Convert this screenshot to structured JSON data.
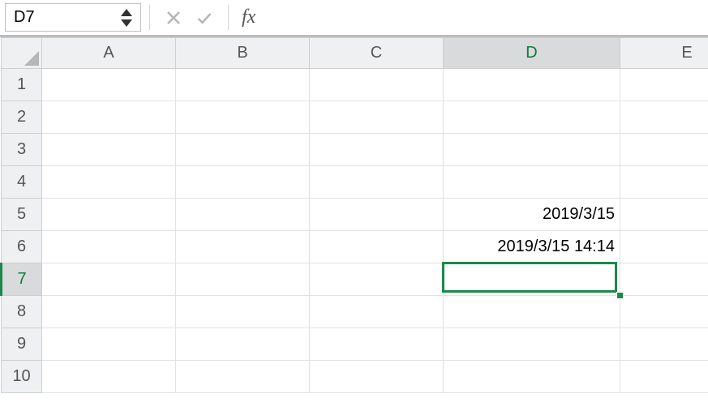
{
  "formula_bar": {
    "name_box_value": "D7",
    "fx_label": "fx",
    "formula_value": ""
  },
  "columns": [
    "A",
    "B",
    "C",
    "D",
    "E"
  ],
  "rows": [
    "1",
    "2",
    "3",
    "4",
    "5",
    "6",
    "7",
    "8",
    "9",
    "10"
  ],
  "active": {
    "col": "D",
    "row": "7"
  },
  "cells": {
    "D5": "2019/3/15",
    "D6": "2019/3/15 14:14"
  },
  "colors": {
    "accent": "#1a8a4a",
    "header_bg": "#eef0f1",
    "grid_line": "#e2e2e2"
  }
}
